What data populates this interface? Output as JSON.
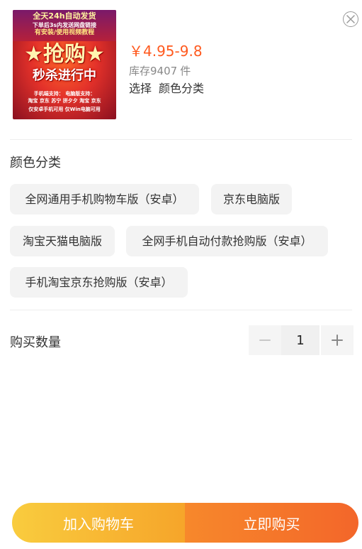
{
  "product": {
    "image_text": {
      "line1": "全天24h自动发货",
      "line2": "下单后3s内发送网盘链接",
      "line3": "有安装/使用视频教程",
      "big1": "★抢购★",
      "big2": "秒杀进行中",
      "small1": "手机端支持：     电脑版支持：",
      "small2": "淘宝 京东 苏宁 拼夕夕    淘宝 京东",
      "small3": "仅安卓手机可用    仅Win电脑可用"
    },
    "price": "￥4.95-9.8",
    "stock_label": "库存9407",
    "stock_unit": "件",
    "select_label": "选择",
    "select_value": "颜色分类"
  },
  "options": {
    "title": "颜色分类",
    "items": [
      "全网通用手机购物车版（安卓）",
      "京东电脑版",
      "淘宝天猫电脑版",
      "全网手机自动付款抢购版（安卓）",
      "手机淘宝京东抢购版（安卓）"
    ]
  },
  "quantity": {
    "label": "购买数量",
    "value": "1"
  },
  "actions": {
    "add_to_cart": "加入购物车",
    "buy_now": "立即购买"
  },
  "colors": {
    "price": "#ff5a1f",
    "cart_gradient_start": "#f9cc3e",
    "cart_gradient_end": "#f6a52a",
    "buy_gradient_start": "#f7882b",
    "buy_gradient_end": "#f3662a"
  },
  "icons": {
    "close": "close-icon",
    "minus": "minus-icon",
    "plus": "plus-icon"
  }
}
